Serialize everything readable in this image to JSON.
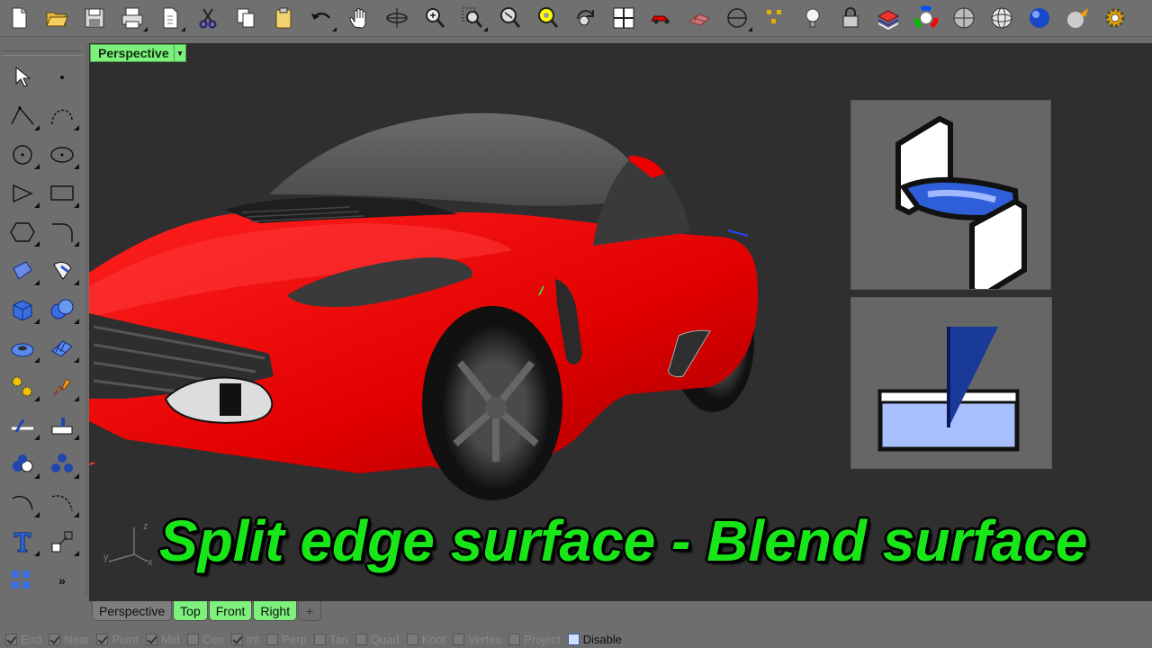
{
  "toolbar": {
    "buttons": [
      {
        "name": "new-file-icon"
      },
      {
        "name": "open-folder-icon"
      },
      {
        "name": "save-icon"
      },
      {
        "name": "print-icon"
      },
      {
        "name": "import-icon"
      },
      {
        "name": "cut-icon"
      },
      {
        "name": "copy-icon"
      },
      {
        "name": "paste-icon"
      },
      {
        "name": "undo-icon"
      },
      {
        "name": "pan-hand-icon"
      },
      {
        "name": "rotate-view-icon"
      },
      {
        "name": "zoom-dynamic-icon"
      },
      {
        "name": "zoom-window-icon"
      },
      {
        "name": "zoom-extents-icon"
      },
      {
        "name": "zoom-selected-icon"
      },
      {
        "name": "rotate-camera-icon"
      },
      {
        "name": "viewport-layout-icon"
      },
      {
        "name": "car-model-icon"
      },
      {
        "name": "grid-plane-icon"
      },
      {
        "name": "cplane-icon"
      },
      {
        "name": "object-snap-icon"
      },
      {
        "name": "light-bulb-icon"
      },
      {
        "name": "lock-icon"
      },
      {
        "name": "layers-icon"
      },
      {
        "name": "color-wheel-icon"
      },
      {
        "name": "shade-sphere-icon"
      },
      {
        "name": "wire-sphere-icon"
      },
      {
        "name": "render-sphere-icon"
      },
      {
        "name": "material-sphere-icon"
      },
      {
        "name": "settings-gear-icon"
      }
    ]
  },
  "viewport": {
    "label": "Perspective",
    "dropdown_glyph": "▾",
    "caption": "Split edge surface - Blend surface",
    "axis": {
      "x": "x",
      "y": "y",
      "z": "z"
    },
    "body_color": "#e00000",
    "background_color": "#2f2f2f"
  },
  "left_tools": {
    "more_glyph": "»"
  },
  "tabs": [
    {
      "label": "Perspective",
      "state": "active"
    },
    {
      "label": "Top",
      "state": "green"
    },
    {
      "label": "Front",
      "state": "green"
    },
    {
      "label": "Right",
      "state": "green"
    }
  ],
  "tab_add_glyph": "+",
  "osnaps": [
    {
      "label": "End",
      "checked": true
    },
    {
      "label": "Near",
      "checked": true
    },
    {
      "label": "Point",
      "checked": true
    },
    {
      "label": "Mid",
      "checked": true
    },
    {
      "label": "Cen",
      "checked": false
    },
    {
      "label": "Int",
      "checked": true
    },
    {
      "label": "Perp",
      "checked": false
    },
    {
      "label": "Tan",
      "checked": false
    },
    {
      "label": "Quad",
      "checked": false
    },
    {
      "label": "Knot",
      "checked": false
    },
    {
      "label": "Vertex",
      "checked": false
    },
    {
      "label": "Project",
      "checked": false
    },
    {
      "label": "Disable",
      "checked": false
    }
  ]
}
